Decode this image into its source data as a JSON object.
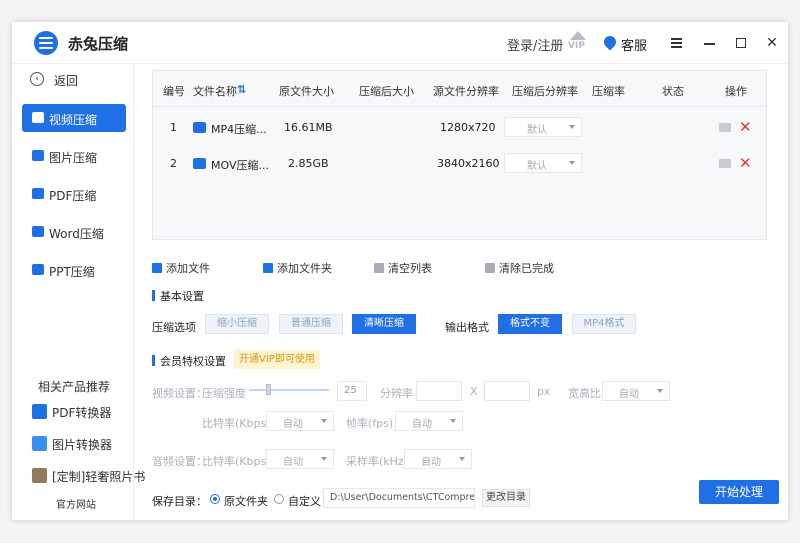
{
  "app": {
    "title": "赤兔压缩",
    "login": "登录/注册",
    "vip_icon": "VIP",
    "service": "客服"
  },
  "sidebar": {
    "back": "返回",
    "items": [
      {
        "label": "视频压缩",
        "icon": "video-icon",
        "color": "#1f6fe5",
        "active": true
      },
      {
        "label": "图片压缩",
        "icon": "image-icon",
        "color": "#1f6fe5",
        "active": false
      },
      {
        "label": "PDF压缩",
        "icon": "pdf-icon",
        "color": "#1f6fe5",
        "active": false
      },
      {
        "label": "Word压缩",
        "icon": "word-icon",
        "color": "#1f6fe5",
        "active": false
      },
      {
        "label": "PPT压缩",
        "icon": "ppt-icon",
        "color": "#1f6fe5",
        "active": false
      }
    ],
    "related_title": "相关产品推荐",
    "related": [
      {
        "label": "PDF转换器",
        "icon": "pdf-converter-icon"
      },
      {
        "label": "图片转换器",
        "icon": "image-converter-icon"
      },
      {
        "label": "[定制]轻奢照片书",
        "icon": "photo-book-icon"
      }
    ],
    "website": "官方网站"
  },
  "table": {
    "headers": [
      "编号",
      "文件名称",
      "原文件大小",
      "压缩后大小",
      "源文件分辨率",
      "压缩后分辨率",
      "压缩率",
      "状态",
      "操作"
    ],
    "sort_icon": "sort-icon",
    "rows": [
      {
        "no": "1",
        "name": "MP4压缩...",
        "size": "16.61MB",
        "compressed_size": "",
        "src_res": "1280x720",
        "out_res": "默认",
        "ratio": "",
        "status": ""
      },
      {
        "no": "2",
        "name": "MOV压缩...",
        "size": "2.85GB",
        "compressed_size": "",
        "src_res": "3840x2160",
        "out_res": "默认",
        "ratio": "",
        "status": ""
      }
    ]
  },
  "actions": {
    "add_file": "添加文件",
    "add_folder": "添加文件夹",
    "clear_list": "清空列表",
    "clear_done": "清除已完成"
  },
  "basic": {
    "title": "基本设置",
    "compress_label": "压缩选项",
    "options": [
      "缩小压缩",
      "普通压缩",
      "清晰压缩"
    ],
    "selected_option": "清晰压缩",
    "format_label": "输出格式",
    "formats": [
      "格式不变",
      "MP4格式"
    ],
    "selected_format": "格式不变"
  },
  "vip": {
    "title": "会员特权设置",
    "badge": "开通VIP即可使用",
    "video_label": "视频设置：",
    "strength_label": "压缩强度",
    "strength_value": "25",
    "strength_level": 0.25,
    "resolution_label": "分辨率",
    "x_sep": "X",
    "px_unit": "px",
    "aspect_label": "宽高比",
    "aspect_value": "自动",
    "bitrate_label": "比特率(Kbps)",
    "bitrate_value": "自动",
    "fps_label": "帧率(fps)",
    "fps_value": "自动",
    "audio_label": "音频设置：",
    "audio_bitrate_label": "比特率(Kbps)",
    "audio_bitrate_value": "自动",
    "sample_label": "采样率(kHz)",
    "sample_value": "自动"
  },
  "save": {
    "label": "保存目录：",
    "opt_original": "原文件夹",
    "opt_custom": "自定义",
    "path": "D:\\User\\Documents\\CTCompres",
    "change": "更改目录",
    "selected": "原文件夹"
  },
  "start": "开始处理",
  "colors": {
    "accent": "#1f6fe5",
    "delete": "#e53935",
    "vip": "#d49b16"
  }
}
